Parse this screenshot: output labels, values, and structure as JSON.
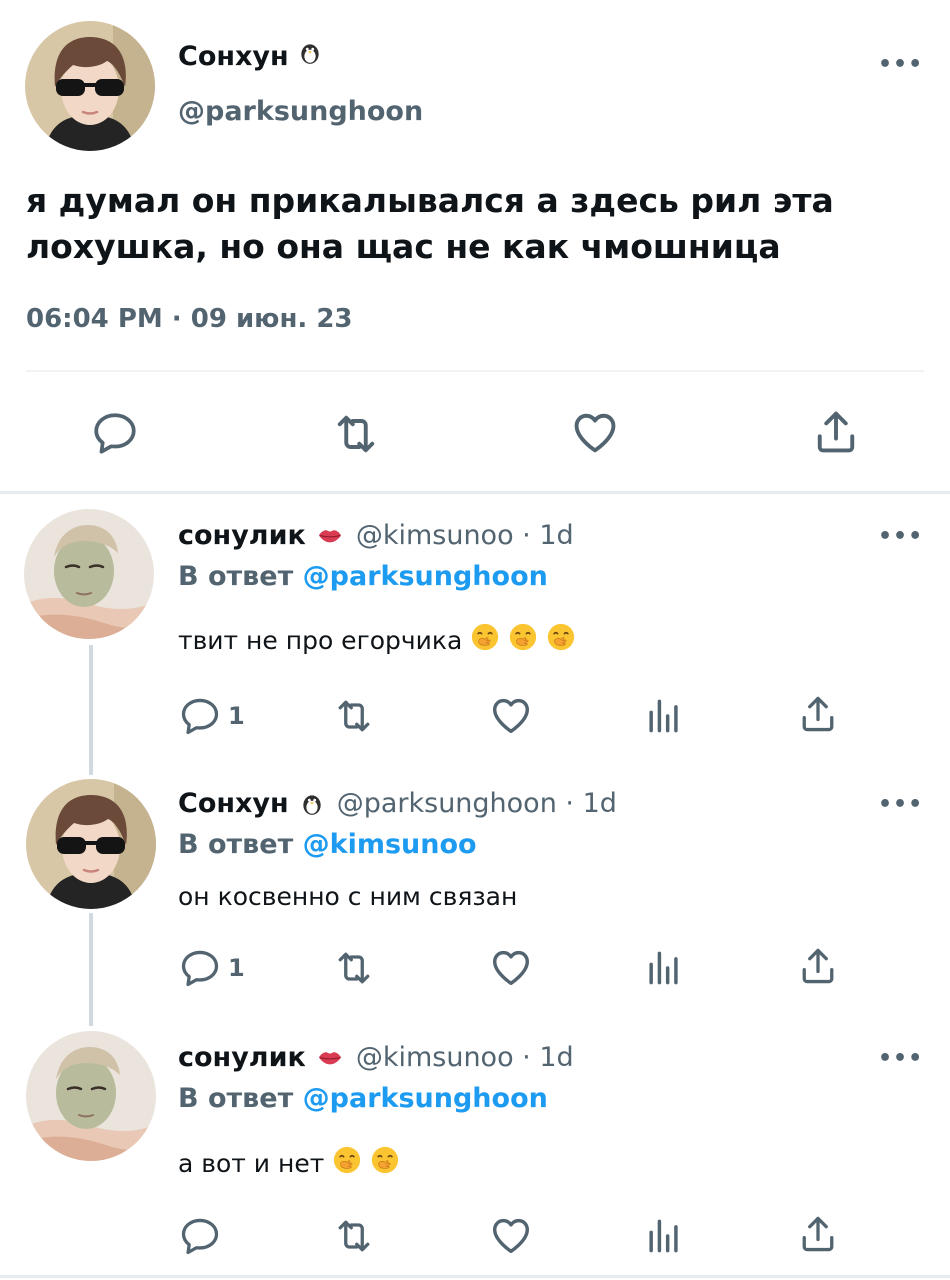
{
  "main_tweet": {
    "name": "Сонхун",
    "handle": "@parksunghoon",
    "text": "я думал он прикалывался а здесь рил эта лохушка, но она щас не как чмошница",
    "timestamp": "06:04 PM · 09 июн. 23",
    "name_badge_icon": "penguin-icon",
    "actions": [
      "reply-icon",
      "retweet-icon",
      "like-icon",
      "share-icon"
    ],
    "more_label": "•••"
  },
  "replies": [
    {
      "name": "сонулик",
      "badge_icon": "lips-icon",
      "meta": "@kimsunoo · 1d",
      "reply_prefix": "В ответ",
      "reply_to": "@parksunghoon",
      "text": "твит не про егорчика",
      "emoji_count": 3,
      "emoji_icon": "hand-over-mouth-emoji",
      "reply_count": "1",
      "more_label": "•••"
    },
    {
      "name": "Сонхун",
      "badge_icon": "penguin-icon",
      "meta": "@parksunghoon · 1d",
      "reply_prefix": "В ответ",
      "reply_to": "@kimsunoo",
      "text": "он косвенно с ним связан",
      "emoji_count": 0,
      "reply_count": "1",
      "more_label": "•••"
    },
    {
      "name": "сонулик",
      "badge_icon": "lips-icon",
      "meta": "@kimsunoo · 1d",
      "reply_prefix": "В ответ",
      "reply_to": "@parksunghoon",
      "text": "а вот и нет",
      "emoji_count": 2,
      "emoji_icon": "hand-over-mouth-emoji",
      "reply_count": "",
      "more_label": "•••"
    }
  ],
  "colors": {
    "text": "#0f1419",
    "secondary": "#536471",
    "link": "#1d9bf0",
    "divider": "#eff3f4",
    "thread_line": "#cfd9de"
  }
}
